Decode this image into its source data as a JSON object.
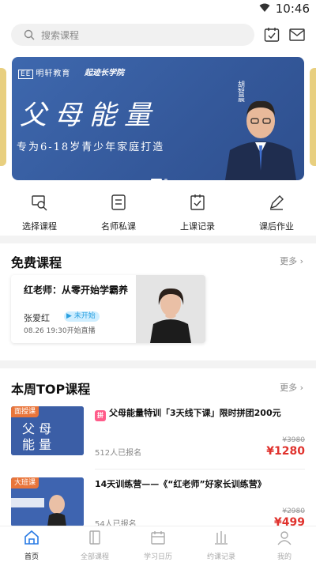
{
  "status_bar": {
    "time": "10:46"
  },
  "search": {
    "placeholder": "搜索课程"
  },
  "banner": {
    "logo_main": "明轩教育",
    "logo_sub": "起迹长学院",
    "title": "父母能量",
    "subtitle": "专为6-18岁青少年家庭打造",
    "teacher_name": "胡智晨",
    "active_slide": 1,
    "slide_count": 2
  },
  "quick_nav": [
    {
      "label": "选择课程",
      "icon": "course-select-icon"
    },
    {
      "label": "名师私课",
      "icon": "private-lesson-icon"
    },
    {
      "label": "上课记录",
      "icon": "class-record-icon"
    },
    {
      "label": "课后作业",
      "icon": "homework-icon"
    }
  ],
  "free_section": {
    "title": "免费课程",
    "more": "更多",
    "card": {
      "title": "红老师：从零开始学霸养成法",
      "teacher": "张爱红",
      "status": "未开始",
      "time": "08.26 19:30开始直播"
    }
  },
  "top_section": {
    "title": "本周TOP课程",
    "more": "更多",
    "courses": [
      {
        "tag": "面授课",
        "badge": "拼",
        "title": "父母能量特训「3天线下课」限时拼团200元",
        "enroll": "512人已报名",
        "old_price": "¥3980",
        "price": "¥1280"
      },
      {
        "tag": "大班课",
        "badge": "",
        "title": "14天训练营——《“红老师”好家长训练营》",
        "enroll": "54人已报名",
        "old_price": "¥2980",
        "price": "¥499"
      }
    ]
  },
  "tabbar": [
    {
      "label": "首页",
      "icon": "home-icon",
      "active": true
    },
    {
      "label": "全部课程",
      "icon": "book-icon",
      "active": false
    },
    {
      "label": "学习日历",
      "icon": "calendar-icon",
      "active": false
    },
    {
      "label": "约课记录",
      "icon": "record-icon",
      "active": false
    },
    {
      "label": "我的",
      "icon": "profile-icon",
      "active": false
    }
  ],
  "colors": {
    "accent_red": "#e0322d",
    "banner_blue": "#3b63a8",
    "badge_orange": "#e9753a",
    "badge_pink": "#ff5c8a"
  }
}
